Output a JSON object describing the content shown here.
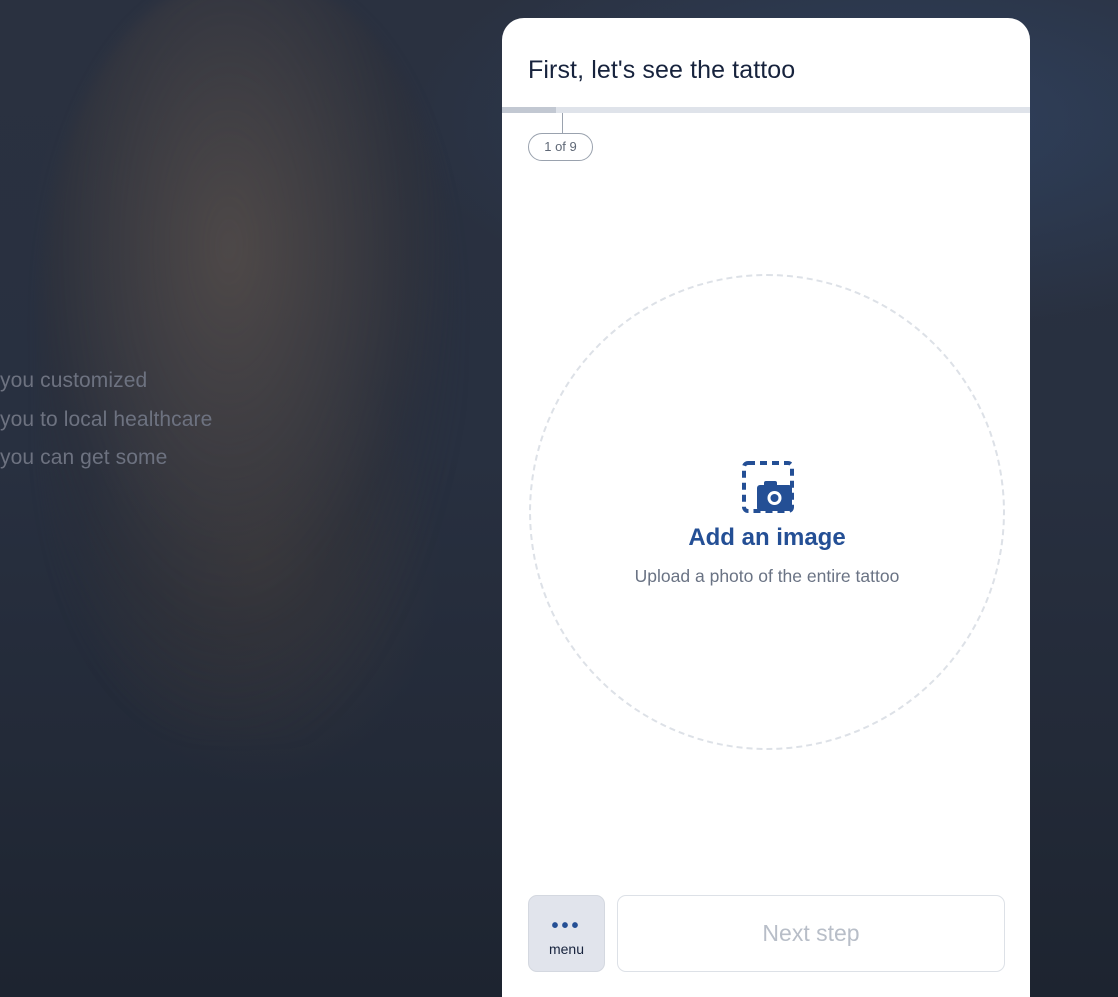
{
  "background": {
    "text_lines": [
      "you customized",
      "you to local healthcare",
      "you can get some"
    ]
  },
  "card": {
    "title": "First, let's see the tattoo",
    "progress": {
      "current": 1,
      "total": 9,
      "label": "1 of 9"
    },
    "upload": {
      "icon": "camera-upload-icon",
      "title": "Add an image",
      "subtitle": "Upload a photo of the entire tattoo"
    },
    "footer": {
      "menu_icon": "more-dots-icon",
      "menu_label": "menu",
      "next_label": "Next step"
    }
  },
  "colors": {
    "accent": "#244f95",
    "title": "#17233d",
    "muted": "#6a7384",
    "disabled_text": "#b8bec8"
  }
}
